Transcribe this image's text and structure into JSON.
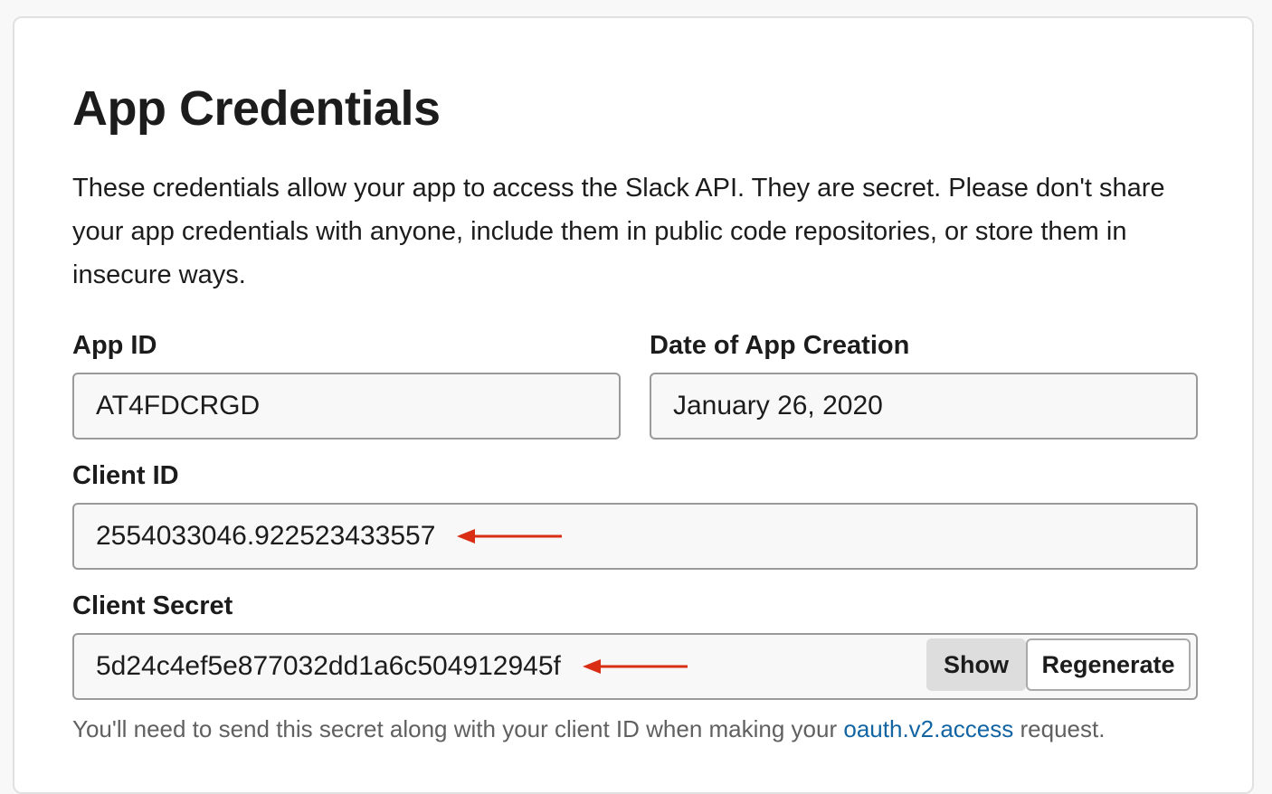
{
  "page": {
    "title": "App Credentials",
    "description": "These credentials allow your app to access the Slack API. They are secret. Please don't share your app credentials with anyone, include them in public code repositories, or store them in insecure ways."
  },
  "fields": {
    "app_id": {
      "label": "App ID",
      "value": "AT4FDCRGD"
    },
    "creation_date": {
      "label": "Date of App Creation",
      "value": "January 26, 2020"
    },
    "client_id": {
      "label": "Client ID",
      "value": "2554033046.922523433557"
    },
    "client_secret": {
      "label": "Client Secret",
      "value": "5d24c4ef5e877032dd1a6c504912945f",
      "show_label": "Show",
      "regenerate_label": "Regenerate"
    }
  },
  "hint": {
    "before": "You'll need to send this secret along with your client ID when making your ",
    "link": "oauth.v2.access",
    "after": " request."
  },
  "colors": {
    "arrow": "#d92d14",
    "link": "#1264a3"
  },
  "icons": {
    "annotation_arrow": "left-arrow-icon"
  }
}
